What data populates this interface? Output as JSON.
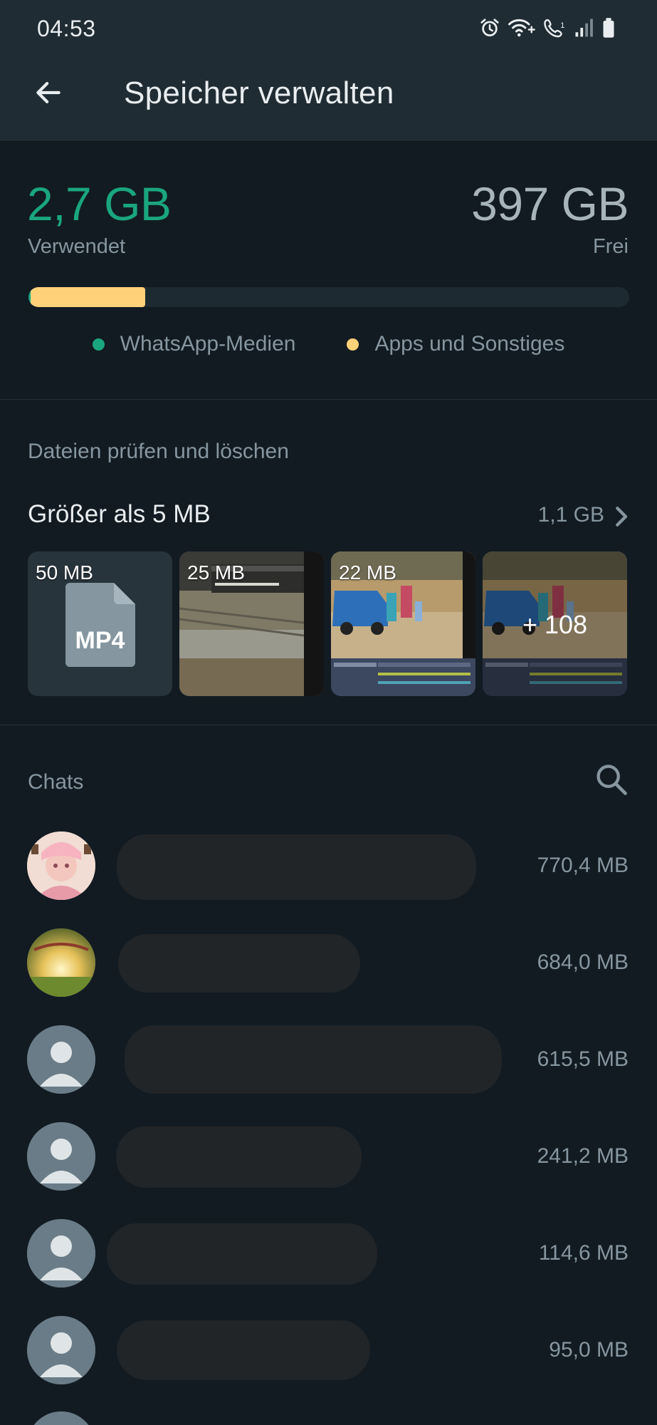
{
  "status_bar": {
    "time": "04:53",
    "icons": [
      "alarm-icon",
      "wifi-calling-icon",
      "call-icon",
      "signal-icon",
      "battery-icon"
    ]
  },
  "app_bar": {
    "back_icon": "arrow-left-icon",
    "title": "Speicher verwalten"
  },
  "storage": {
    "used_value": "2,7 GB",
    "used_label": "Verwendet",
    "free_value": "397 GB",
    "free_label": "Frei",
    "bar": {
      "whatsapp_fraction": 0.004,
      "apps_fraction": 0.19
    },
    "legend": [
      {
        "label": "WhatsApp-Medien",
        "color": "#1aa67f"
      },
      {
        "label": "Apps und Sonstiges",
        "color": "#ffd27a"
      }
    ]
  },
  "review": {
    "section_title": "Dateien prüfen und löschen",
    "large_files_label": "Größer als 5 MB",
    "large_files_size": "1,1 GB",
    "chevron_icon": "chevron-right-icon",
    "thumbnails": [
      {
        "label": "50 MB",
        "kind": "file",
        "file_type": "MP4"
      },
      {
        "label": "25 MB",
        "kind": "image"
      },
      {
        "label": "22 MB",
        "kind": "image"
      },
      {
        "label": "+ 108",
        "kind": "more"
      }
    ]
  },
  "chats": {
    "section_title": "Chats",
    "search_icon": "search-icon",
    "rows": [
      {
        "size": "770,4 MB",
        "avatar": "photo"
      },
      {
        "size": "684,0 MB",
        "avatar": "photo"
      },
      {
        "size": "615,5 MB",
        "avatar": "default"
      },
      {
        "size": "241,2 MB",
        "avatar": "default"
      },
      {
        "size": "114,6 MB",
        "avatar": "default"
      },
      {
        "size": "95,0 MB",
        "avatar": "default"
      }
    ]
  },
  "colors": {
    "background": "#121b22",
    "header": "#1f2c34",
    "accent_green": "#1aa67f",
    "accent_yellow": "#ffd27a",
    "secondary_text": "#8696a0"
  }
}
